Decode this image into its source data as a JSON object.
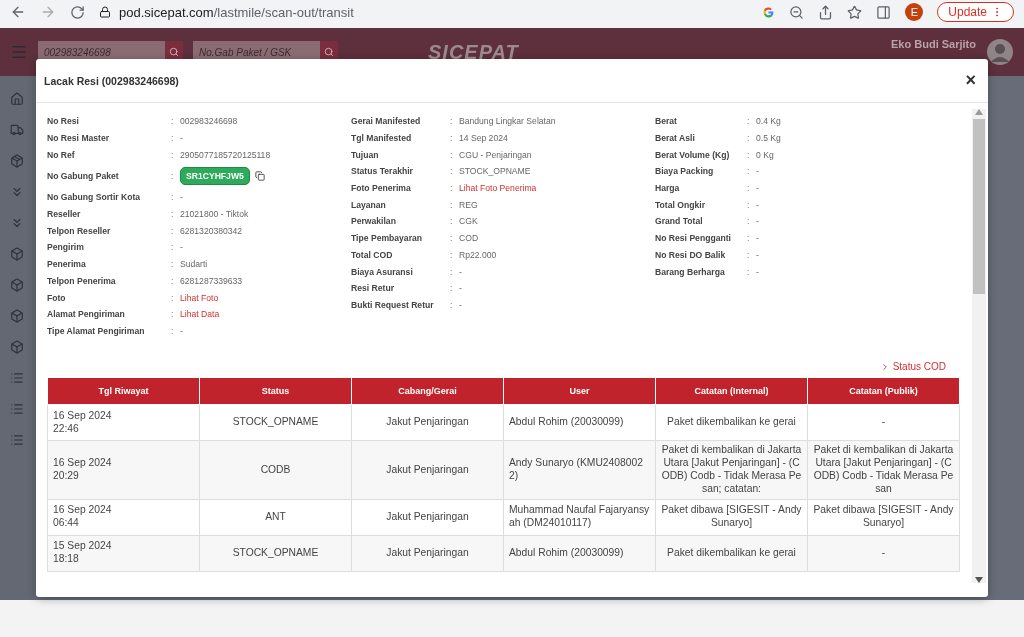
{
  "browser": {
    "url_host": "pod.sicepat.com",
    "url_path": "/lastmile/scan-out/transit",
    "profile_initial": "E",
    "update_label": "Update"
  },
  "header": {
    "search_value": "002983246698",
    "search2_placeholder": "No.Gab Paket / GSK",
    "logo": "SICEPAT",
    "user_name": "Eko Budi Sarjito"
  },
  "modal": {
    "title": "Lacak Resi (002983246698)",
    "close": "×",
    "separator": ":",
    "detail_columns": [
      [
        {
          "label": "No Resi",
          "value": "002983246698",
          "kind": "text"
        },
        {
          "label": "No Resi Master",
          "value": "-",
          "kind": "text"
        },
        {
          "label": "No Ref",
          "value": "2905077185720125118",
          "kind": "text"
        },
        {
          "label": "No Gabung Paket",
          "value": "SR1CYHFJW5",
          "kind": "badge"
        },
        {
          "label": "No Gabung Sortir Kota",
          "value": "-",
          "kind": "text"
        },
        {
          "label": "Reseller",
          "value": "21021800 - Tiktok",
          "kind": "text"
        },
        {
          "label": "Telpon Reseller",
          "value": "6281320380342",
          "kind": "text"
        },
        {
          "label": "Pengirim",
          "value": "-",
          "kind": "text"
        },
        {
          "label": "Penerima",
          "value": "Sudarti",
          "kind": "text"
        },
        {
          "label": "Telpon Penerima",
          "value": "6281287339633",
          "kind": "text"
        },
        {
          "label": "Foto",
          "value": "Lihat Foto",
          "kind": "link"
        },
        {
          "label": "Alamat Pengiriman",
          "value": "Lihat Data",
          "kind": "link"
        },
        {
          "label": "Tipe Alamat Pengiriman",
          "value": "-",
          "kind": "text"
        }
      ],
      [
        {
          "label": "Gerai Manifested",
          "value": "Bandung Lingkar Selatan",
          "kind": "text"
        },
        {
          "label": "Tgl Manifested",
          "value": "14 Sep 2024",
          "kind": "text"
        },
        {
          "label": "Tujuan",
          "value": "CGU - Penjaringan",
          "kind": "text"
        },
        {
          "label": "Status Terakhir",
          "value": "STOCK_OPNAME",
          "kind": "text"
        },
        {
          "label": "Foto Penerima",
          "value": "Lihat Foto Penerima",
          "kind": "link"
        },
        {
          "label": "Layanan",
          "value": "REG",
          "kind": "text"
        },
        {
          "label": "Perwakilan",
          "value": "CGK",
          "kind": "text"
        },
        {
          "label": "Tipe Pembayaran",
          "value": "COD",
          "kind": "text"
        },
        {
          "label": "Total COD",
          "value": "Rp22.000",
          "kind": "text"
        },
        {
          "label": "Biaya Asuransi",
          "value": "-",
          "kind": "text"
        },
        {
          "label": "Resi Retur",
          "value": "-",
          "kind": "text"
        },
        {
          "label": "Bukti Request Retur",
          "value": "-",
          "kind": "text"
        }
      ],
      [
        {
          "label": "Berat",
          "value": "0.4 Kg",
          "kind": "text"
        },
        {
          "label": "Berat Asli",
          "value": "0.5 Kg",
          "kind": "text"
        },
        {
          "label": "Berat Volume (Kg)",
          "value": "0 Kg",
          "kind": "text"
        },
        {
          "label": "Biaya Packing",
          "value": "-",
          "kind": "text"
        },
        {
          "label": "Harga",
          "value": "-",
          "kind": "text"
        },
        {
          "label": "Total Ongkir",
          "value": "-",
          "kind": "text"
        },
        {
          "label": "Grand Total",
          "value": "-",
          "kind": "text"
        },
        {
          "label": "No Resi Pengganti",
          "value": "-",
          "kind": "text"
        },
        {
          "label": "No Resi DO Balik",
          "value": "-",
          "kind": "text"
        },
        {
          "label": "Barang Berharga",
          "value": "-",
          "kind": "text"
        }
      ]
    ],
    "status_cod_link": "Status COD",
    "table": {
      "columns": [
        "Tgl Riwayat",
        "Status",
        "Cabang/Gerai",
        "User",
        "Catatan (Internal)",
        "Catatan (Publik)"
      ],
      "rows": [
        [
          "16 Sep 2024\n22:46",
          "STOCK_OPNAME",
          "Jakut Penjaringan",
          "Abdul Rohim (20030099)",
          "Paket dikembalikan ke gerai",
          "-"
        ],
        [
          "16 Sep 2024\n20:29",
          "CODB",
          "Jakut Penjaringan",
          "Andy Sunaryo (KMU24080022)",
          "Paket di kembalikan di Jakarta Utara [Jakut Penjaringan] - (CODB) Codb - Tidak Merasa Pesan; catatan:",
          "Paket di kembalikan di Jakarta Utara [Jakut Penjaringan] - (CODB) Codb - Tidak Merasa Pesan"
        ],
        [
          "16 Sep 2024\n06:44",
          "ANT",
          "Jakut Penjaringan",
          "Muhammad Naufal Fajaryansyah (DM24010117)",
          "Paket dibawa [SIGESIT - Andy Sunaryo]",
          "Paket dibawa [SIGESIT - Andy Sunaryo]"
        ],
        [
          "15 Sep 2024\n18:18",
          "STOCK_OPNAME",
          "Jakut Penjaringan",
          "Abdul Rohim (20030099)",
          "Paket dikembalikan ke gerai",
          "-"
        ]
      ]
    }
  }
}
